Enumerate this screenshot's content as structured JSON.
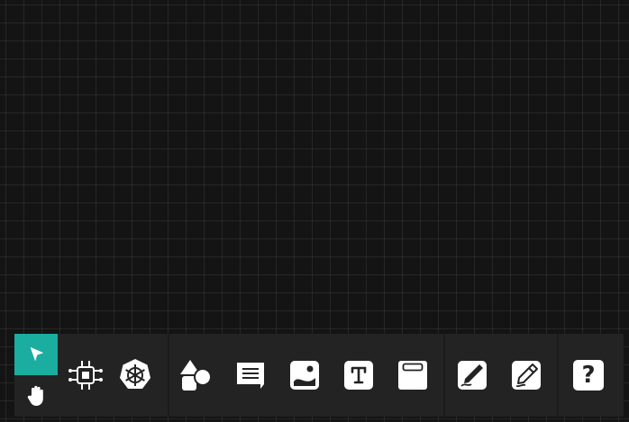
{
  "canvas": {
    "background": "#141414",
    "grid": true
  },
  "toolbar": {
    "accent_color": "#1aada0",
    "modes": [
      {
        "name": "select",
        "icon": "cursor-arrow-icon",
        "active": true
      },
      {
        "name": "pan",
        "icon": "hand-icon",
        "active": false
      }
    ],
    "groups": [
      [
        {
          "name": "component",
          "icon": "chip-icon"
        },
        {
          "name": "kubernetes",
          "icon": "helm-wheel-icon"
        }
      ],
      [
        {
          "name": "shapes",
          "icon": "shapes-icon"
        },
        {
          "name": "comment",
          "icon": "speech-bubble-icon"
        },
        {
          "name": "image",
          "icon": "image-icon"
        },
        {
          "name": "text",
          "icon": "text-t-icon"
        },
        {
          "name": "frame",
          "icon": "frame-icon"
        }
      ],
      [
        {
          "name": "pen",
          "icon": "pen-nib-icon"
        },
        {
          "name": "pencil",
          "icon": "pencil-icon"
        }
      ],
      [
        {
          "name": "help",
          "icon": "question-mark-icon",
          "label": "?"
        }
      ]
    ]
  }
}
